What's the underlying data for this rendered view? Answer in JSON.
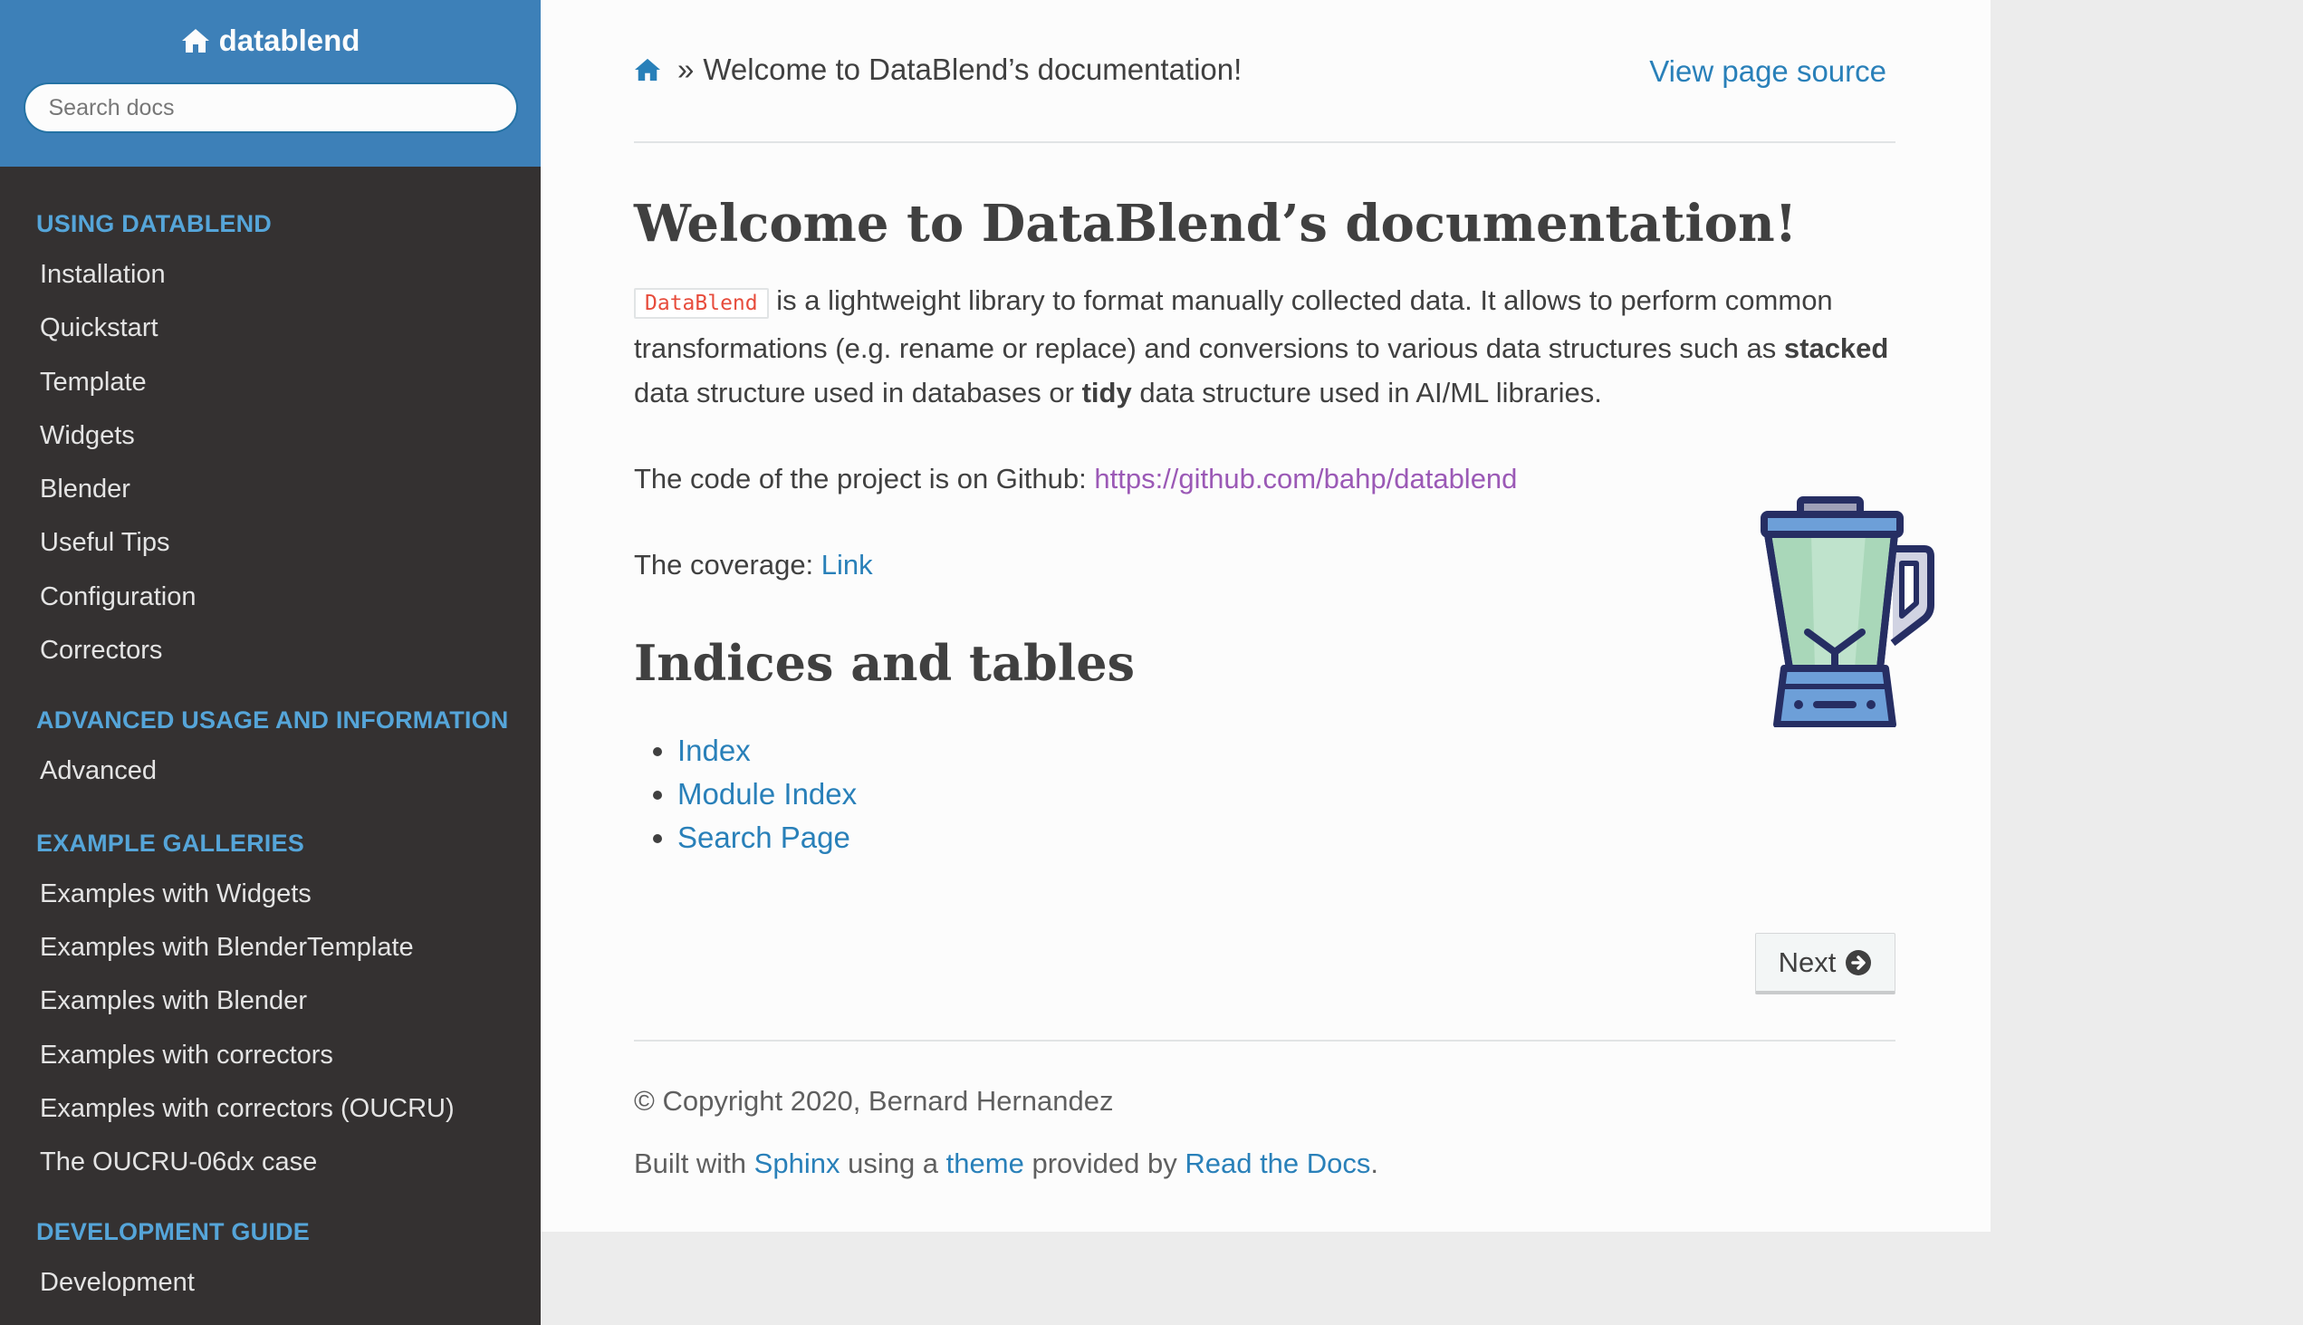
{
  "sidebar": {
    "project_name": "datablend",
    "search_placeholder": "Search docs",
    "sections": [
      {
        "caption": "USING DATABLEND",
        "items": [
          "Installation",
          "Quickstart",
          "Template",
          "Widgets",
          "Blender",
          "Useful Tips",
          "Configuration",
          "Correctors"
        ]
      },
      {
        "caption": "ADVANCED USAGE AND INFORMATION",
        "items": [
          "Advanced"
        ]
      },
      {
        "caption": "EXAMPLE GALLERIES",
        "items": [
          "Examples with Widgets",
          "Examples with BlenderTemplate",
          "Examples with Blender",
          "Examples with correctors",
          "Examples with correctors (OUCRU)",
          "The OUCRU-06dx case"
        ]
      },
      {
        "caption": "DEVELOPMENT GUIDE",
        "items": [
          "Development"
        ]
      }
    ]
  },
  "breadcrumb": {
    "separator": "»",
    "current": "Welcome to DataBlend’s documentation!",
    "view_source": "View page source"
  },
  "main": {
    "title": "Welcome to DataBlend’s documentation!",
    "intro": {
      "code": "DataBlend",
      "text1": " is a lightweight library to format manually collected data. It allows to perform common transformations (e.g. rename or replace) and conversions to various data structures such as ",
      "bold1": "stacked",
      "text2": " data structure used in databases or ",
      "bold2": "tidy",
      "text3": " data structure used in AI/ML libraries."
    },
    "github_prefix": "The code of the project is on Github: ",
    "github_url": "https://github.com/bahp/datablend",
    "coverage_prefix": "The coverage: ",
    "coverage_link": "Link",
    "indices_title": "Indices and tables",
    "indices": [
      "Index",
      "Module Index",
      "Search Page"
    ],
    "next_label": "Next"
  },
  "footer": {
    "copyright": "© Copyright 2020, Bernard Hernandez",
    "built_prefix": "Built with ",
    "sphinx": "Sphinx",
    "using": " using a ",
    "theme": "theme",
    "provided": " provided by ",
    "rtd": "Read the Docs",
    "end": "."
  },
  "colors": {
    "sidebar_top": "#3d80b8",
    "sidebar_bg": "#343131",
    "caption": "#55a5d9",
    "link": "#2980b9",
    "visited_link": "#9b59b6",
    "code_text": "#e74c3c"
  },
  "icons": [
    "home-icon",
    "arrow-circle-right-icon",
    "blender-logo"
  ]
}
